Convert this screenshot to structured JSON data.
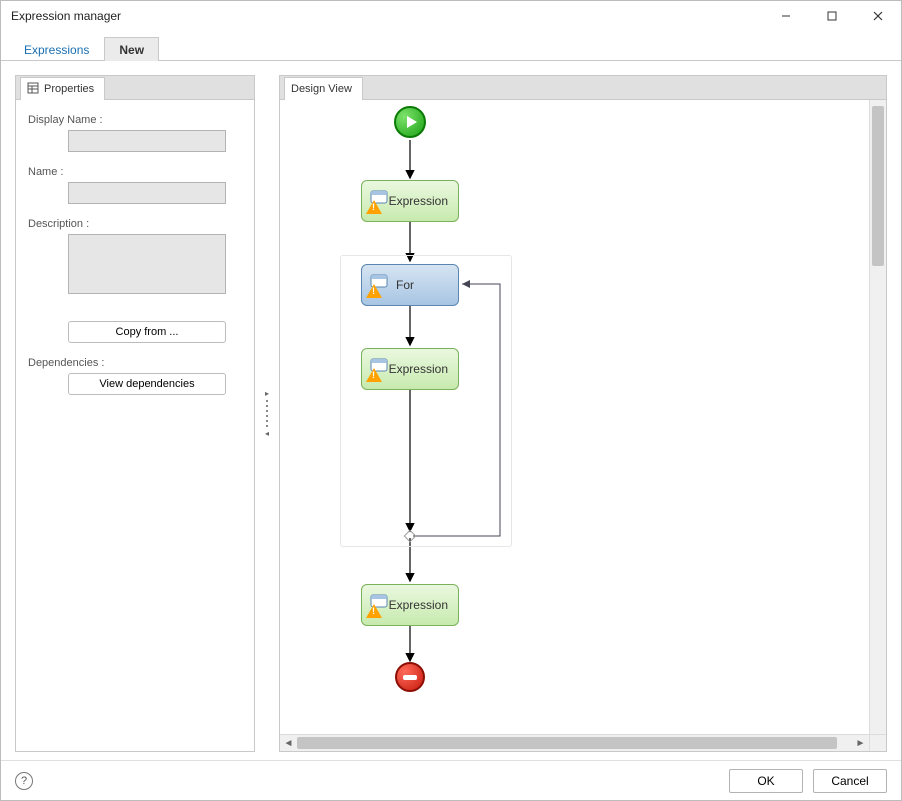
{
  "window": {
    "title": "Expression manager"
  },
  "tabs": {
    "inactive": "Expressions",
    "active": "New"
  },
  "properties_panel": {
    "tab_label": "Properties",
    "display_name_label": "Display Name :",
    "display_name_value": "",
    "name_label": "Name :",
    "name_value": "",
    "description_label": "Description :",
    "description_value": "",
    "copy_from_label": "Copy from ...",
    "dependencies_label": "Dependencies :",
    "view_dependencies_label": "View dependencies"
  },
  "design_panel": {
    "tab_label": "Design View"
  },
  "flow": {
    "start_icon": "play-circle",
    "end_icon": "stop-circle",
    "nodes": [
      {
        "label": "Expression"
      },
      {
        "label": "For"
      },
      {
        "label": "Expression"
      },
      {
        "label": "Expression"
      }
    ]
  },
  "bottom": {
    "ok_label": "OK",
    "cancel_label": "Cancel"
  }
}
